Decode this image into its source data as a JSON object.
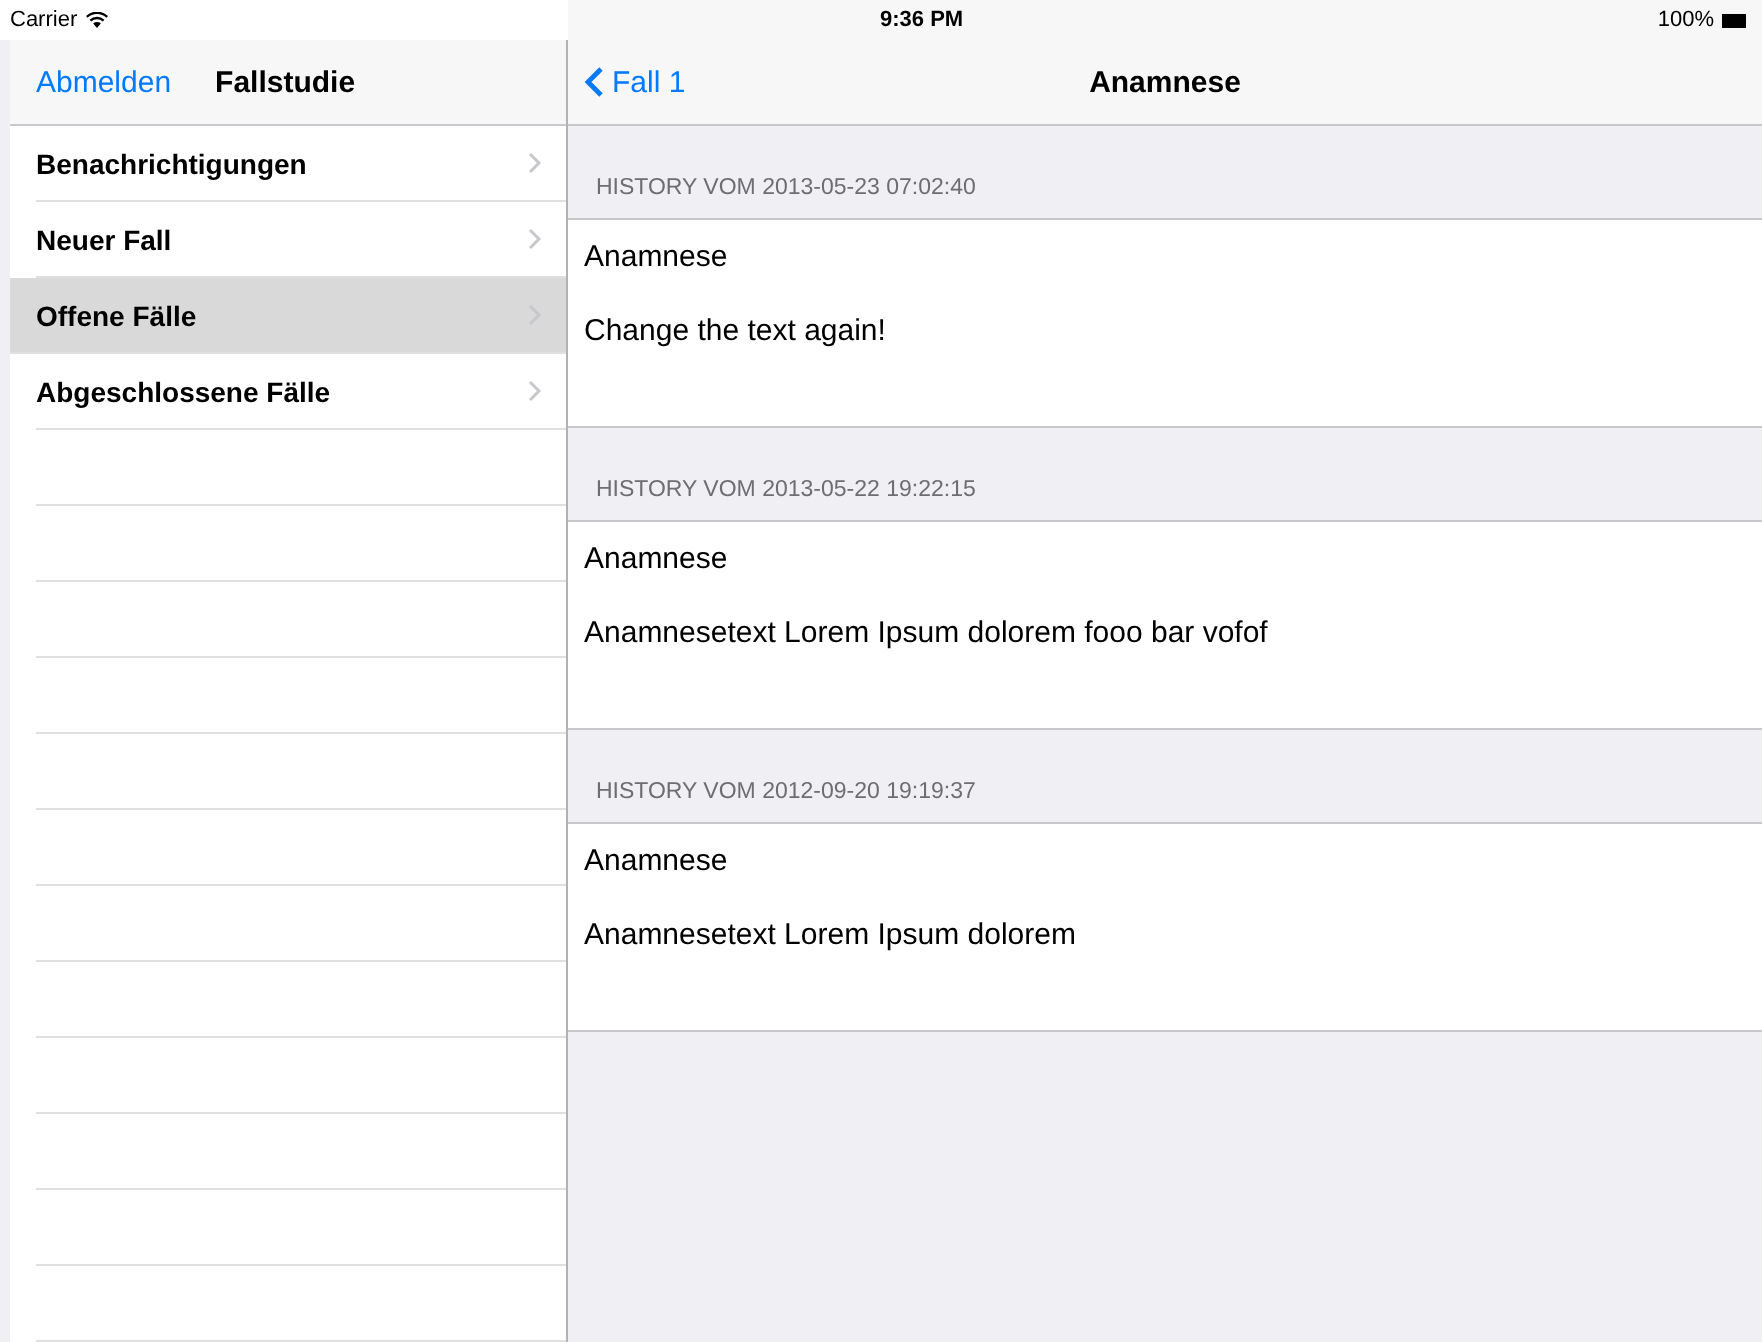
{
  "status_bar": {
    "carrier": "Carrier",
    "time": "9:36 PM",
    "battery": "100%"
  },
  "sidebar": {
    "back_button": "Abmelden",
    "title": "Fallstudie",
    "items": [
      {
        "label": "Benachrichtigungen",
        "selected": false
      },
      {
        "label": "Neuer Fall",
        "selected": false
      },
      {
        "label": "Offene Fälle",
        "selected": true
      },
      {
        "label": "Abgeschlossene Fälle",
        "selected": false
      }
    ]
  },
  "detail": {
    "back_button": "Fall 1",
    "title": "Anamnese",
    "sections": [
      {
        "header": "HISTORY VOM 2013-05-23 07:02:40",
        "title": "Anamnese",
        "text": "Change the text again!"
      },
      {
        "header": "HISTORY VOM 2013-05-22 19:22:15",
        "title": "Anamnese",
        "text": "Anamnesetext Lorem Ipsum dolorem fooo bar vofof"
      },
      {
        "header": "HISTORY VOM 2012-09-20 19:19:37",
        "title": "Anamnese",
        "text": "Anamnesetext Lorem Ipsum dolorem"
      }
    ]
  }
}
